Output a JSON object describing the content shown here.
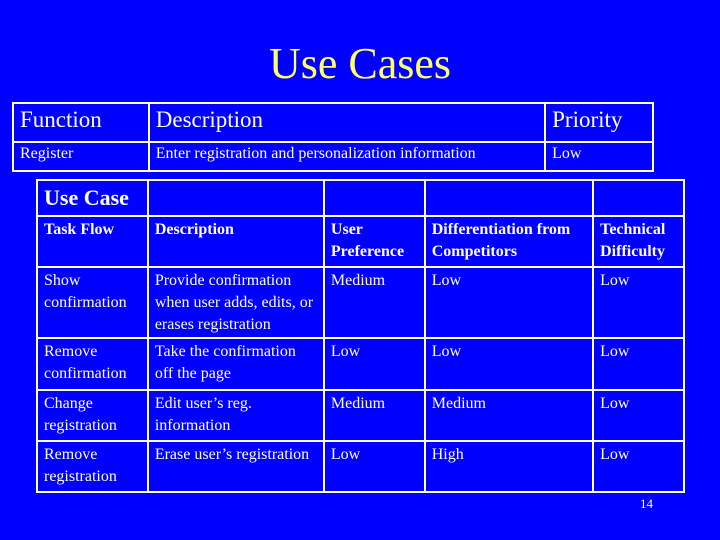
{
  "title": "Use Cases",
  "function_table": {
    "headers": [
      "Function",
      "Description",
      "Priority"
    ],
    "rows": [
      [
        "Register",
        "Enter registration and personalization information",
        "Low"
      ]
    ]
  },
  "use_case_table": {
    "caption": "Use Case",
    "headers": [
      "Task Flow",
      "Description",
      "User Preference",
      "Differentiation from Competitors",
      "Technical Difficulty"
    ],
    "rows": [
      [
        "Show confirmation",
        "Provide confirmation when user adds, edits, or erases registration",
        "Medium",
        "Low",
        "Low"
      ],
      [
        "Remove confirmation",
        "Take the confirmation off the page",
        "Low",
        "Low",
        "Low"
      ],
      [
        "Change registration",
        "Edit user’s reg. information",
        "Medium",
        "Medium",
        "Low"
      ],
      [
        "Remove registration",
        "Erase user’s registration",
        "Low",
        "High",
        "Low"
      ]
    ]
  },
  "page_number": "14",
  "colors": {
    "background": "#0000FF",
    "title": "#FFFF66",
    "text": "#FFFFFF"
  }
}
